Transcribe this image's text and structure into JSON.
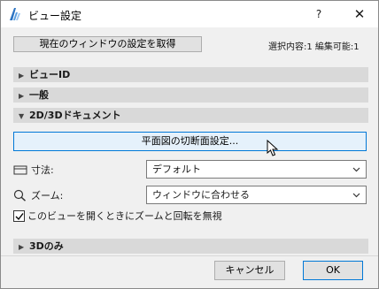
{
  "window": {
    "title": "ビュー設定",
    "help_label": "?",
    "close_label": "✕"
  },
  "toolbar": {
    "get_settings_label": "現在のウィンドウの設定を取得",
    "selection_info": "選択内容:1 編集可能:1"
  },
  "sections": [
    {
      "label": "ビューID",
      "expanded": false
    },
    {
      "label": "一般",
      "expanded": false
    },
    {
      "label": "2D/3Dドキュメント",
      "expanded": true
    },
    {
      "label": "3Dのみ",
      "expanded": false
    }
  ],
  "document_section": {
    "cut_plane_button_label": "平面図の切断面設定...",
    "size_label": "寸法:",
    "size_value": "デフォルト",
    "zoom_label": "ズーム:",
    "zoom_value": "ウィンドウに合わせる",
    "ignore_zoom_label": "このビューを開くときにズームと回転を無視",
    "ignore_zoom_checked": true
  },
  "footer": {
    "cancel_label": "キャンセル",
    "ok_label": "OK"
  },
  "colors": {
    "accent": "#0078d7",
    "section_bg": "#d9d9d9",
    "dialog_bg": "#f0f0f0"
  }
}
